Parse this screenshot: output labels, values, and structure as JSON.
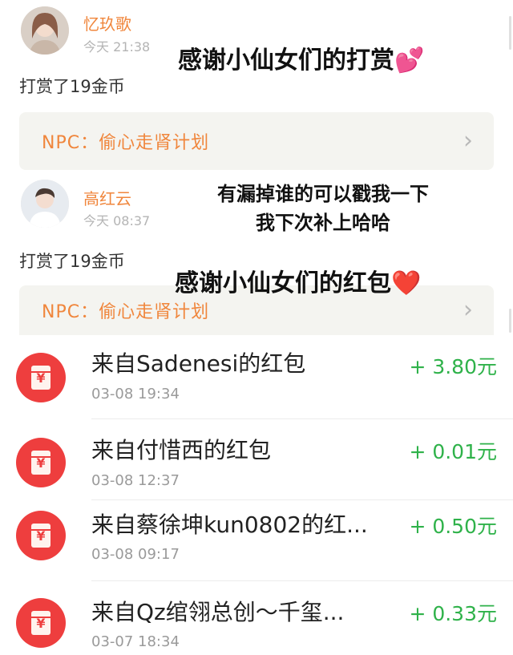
{
  "tips": [
    {
      "user": "忆玖歌",
      "time": "今天 21:38",
      "text": "打赏了19金币",
      "npc_label": "NPC：偷心走肾计划"
    },
    {
      "user": "高红云",
      "time": "今天 08:37",
      "text": "打赏了19金币",
      "npc_label": "NPC：偷心走肾计划"
    }
  ],
  "overlays": {
    "thanks_tips": "感谢小仙女们的打赏💕",
    "missed_line1": "有漏掉谁的可以戳我一下",
    "missed_line2": "我下次补上哈哈",
    "thanks_packets": "感谢小仙女们的红包❤️"
  },
  "red_packets": [
    {
      "title": "来自Sadenesi的红包",
      "date": "03-08 19:34",
      "amount": "+ 3.80元"
    },
    {
      "title": "来自付惜西的红包",
      "date": "03-08 12:37",
      "amount": "+ 0.01元"
    },
    {
      "title": "来自蔡徐坤kun0802的红...",
      "date": "03-08 09:17",
      "amount": "+ 0.50元"
    },
    {
      "title": "来自Qz绾翎总创～千玺...",
      "date": "03-07 18:34",
      "amount": "+ 0.33元"
    }
  ],
  "colors": {
    "accent_orange": "#f0863c",
    "amount_green": "#2fb24a",
    "packet_red": "#ee3e3e"
  },
  "icons": {
    "chevron": "chevron-right-icon",
    "packet": "red-packet-icon"
  }
}
